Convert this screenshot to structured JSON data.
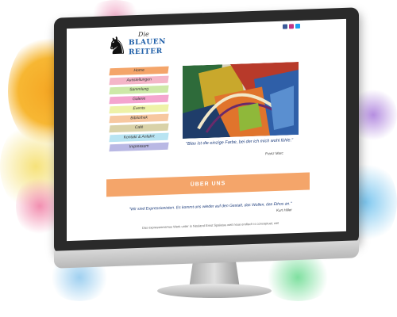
{
  "site": {
    "logo": {
      "line1": "Die",
      "line2": "BLAUEN",
      "line3": "REITER"
    },
    "nav": [
      {
        "label": "Home",
        "color": "#f4a56a"
      },
      {
        "label": "Ausstellungen",
        "color": "#f4b6c8"
      },
      {
        "label": "Sammlung",
        "color": "#cde9a8"
      },
      {
        "label": "Galerie",
        "color": "#f4a5cf"
      },
      {
        "label": "Events",
        "color": "#eef2a8"
      },
      {
        "label": "Bibliothek",
        "color": "#f7c8a0"
      },
      {
        "label": "Café",
        "color": "#d9d2a8"
      },
      {
        "label": "Kontakt & Anfahrt",
        "color": "#b8e4f2"
      },
      {
        "label": "Impressum",
        "color": "#b9b8e4"
      }
    ],
    "quote1": "\"Blau ist die einzige Farbe, bei der ich mich wohl fühle.\"",
    "author1": "Franz Marc",
    "banner": "ÜBER UNS",
    "quote2": "\"Wir sind Expressionisten. Es kommt uns wieder auf den Gestalt, das Wollen, das Ethos an.\"",
    "author2": "Kurt Hiller",
    "footer_text": "Das expressionismus Werk unter in Neuland Ernst Spalatus weit neue endlech is conceptual, wel"
  },
  "colors": {
    "banner": "#f4a56a",
    "accent_blue": "#1f5fa8"
  }
}
